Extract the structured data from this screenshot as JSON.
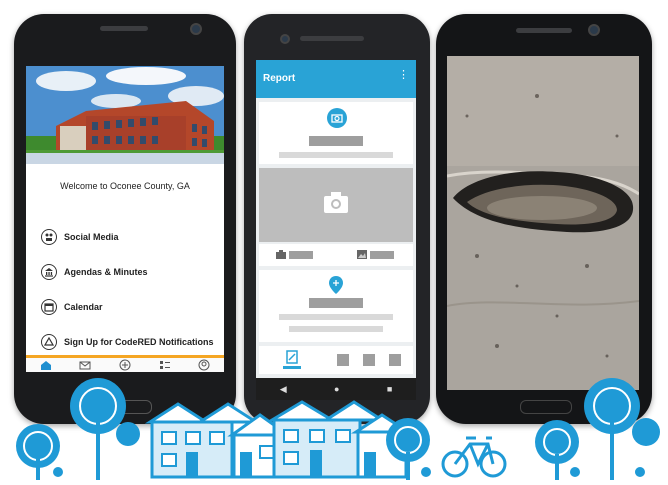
{
  "phone1": {
    "welcome": "Welcome to Oconee County, GA",
    "menu": [
      {
        "label": "Social Media",
        "icon": "social-media-icon"
      },
      {
        "label": "Agendas & Minutes",
        "icon": "government-building-icon"
      },
      {
        "label": "Calendar",
        "icon": "calendar-icon"
      },
      {
        "label": "Sign Up for CodeRED Notifications",
        "icon": "alert-icon"
      }
    ],
    "tabs": [
      "home-icon",
      "mail-icon",
      "plus-circle-icon",
      "list-icon",
      "profile-icon"
    ],
    "colors": {
      "accent": "#f5a623",
      "home_tab": "#1f8fd0"
    }
  },
  "phone2": {
    "title": "Report",
    "more": "⋮",
    "colors": {
      "appbar": "#29a3d6"
    }
  },
  "phone3": {
    "image": "pothole-photo"
  }
}
